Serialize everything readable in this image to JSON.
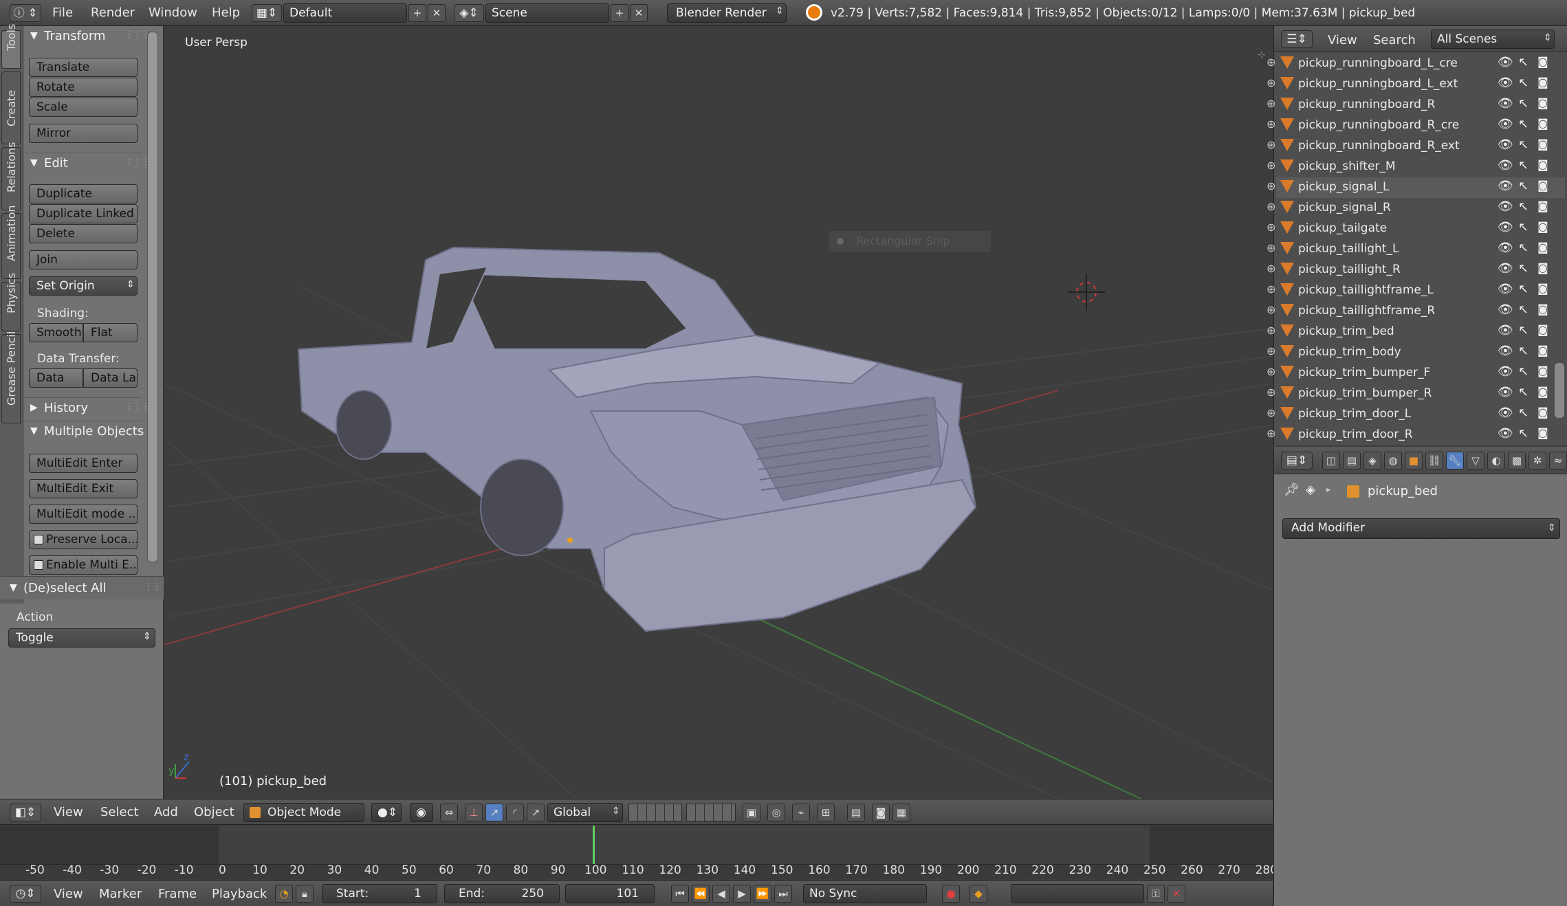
{
  "topbar": {
    "menus": [
      "File",
      "Render",
      "Window",
      "Help"
    ],
    "layout": "Default",
    "scene": "Scene",
    "engine": "Blender Render",
    "stats": "v2.79 | Verts:7,582 | Faces:9,814 | Tris:9,852 | Objects:0/12 | Lamps:0/0 | Mem:37.63M | pickup_bed"
  },
  "toolshelf": {
    "tabs": [
      "Tools",
      "Create",
      "Relations",
      "Animation",
      "Physics",
      "Grease Pencil"
    ],
    "transform_header": "Transform",
    "translate": "Translate",
    "rotate": "Rotate",
    "scale": "Scale",
    "mirror": "Mirror",
    "edit_header": "Edit",
    "duplicate": "Duplicate",
    "duplicate_linked": "Duplicate Linked",
    "delete": "Delete",
    "join": "Join",
    "set_origin": "Set Origin",
    "shading_label": "Shading:",
    "smooth": "Smooth",
    "flat": "Flat",
    "data_transfer_label": "Data Transfer:",
    "data": "Data",
    "data_layout": "Data La",
    "history_header": "History",
    "multiple_objects_header": "Multiple Objects",
    "multiedit_enter": "MultiEdit Enter",
    "multiedit_exit": "MultiEdit Exit",
    "multiedit_mode": "MultiEdit mode ...",
    "preserve_local": "Preserve Loca...",
    "enable_multi": "Enable Multi E...",
    "deselect_header": "(De)select All",
    "action_label": "Action",
    "action_value": "Toggle"
  },
  "viewport": {
    "view_label": "User Persp",
    "object_label": "(101) pickup_bed",
    "ghost_tooltip": "Rectangular Snip",
    "axis_z": "z",
    "axis_y": "y"
  },
  "view3d_header": {
    "menus": [
      "View",
      "Select",
      "Add",
      "Object"
    ],
    "mode": "Object Mode",
    "orientation": "Global"
  },
  "timeline": {
    "ticks": [
      "-50",
      "-40",
      "-30",
      "-20",
      "-10",
      "0",
      "10",
      "20",
      "30",
      "40",
      "50",
      "60",
      "70",
      "80",
      "90",
      "100",
      "110",
      "120",
      "130",
      "140",
      "150",
      "160",
      "170",
      "180",
      "190",
      "200",
      "210",
      "220",
      "230",
      "240",
      "250",
      "260",
      "270",
      "280"
    ],
    "current_frame_marker": 100
  },
  "timeline_header": {
    "menus": [
      "View",
      "Marker",
      "Frame",
      "Playback"
    ],
    "start_label": "Start:",
    "start_value": "1",
    "end_label": "End:",
    "end_value": "250",
    "current": "101",
    "sync": "No Sync"
  },
  "outliner": {
    "view": "View",
    "search": "Search",
    "scenes": "All Scenes",
    "items": [
      "pickup_runningboard_L_cre",
      "pickup_runningboard_L_ext",
      "pickup_runningboard_R",
      "pickup_runningboard_R_cre",
      "pickup_runningboard_R_ext",
      "pickup_shifter_M",
      "pickup_signal_L",
      "pickup_signal_R",
      "pickup_tailgate",
      "pickup_taillight_L",
      "pickup_taillight_R",
      "pickup_taillightframe_L",
      "pickup_taillightframe_R",
      "pickup_trim_bed",
      "pickup_trim_body",
      "pickup_trim_bumper_F",
      "pickup_trim_bumper_R",
      "pickup_trim_door_L",
      "pickup_trim_door_R"
    ]
  },
  "properties": {
    "object_name": "pickup_bed",
    "add_modifier": "Add Modifier"
  },
  "colors": {
    "viewport_bg": "#3d3d3d",
    "panel_bg": "#727272",
    "orange": "#d97b2a",
    "timeline_green": "#5fd35f"
  }
}
